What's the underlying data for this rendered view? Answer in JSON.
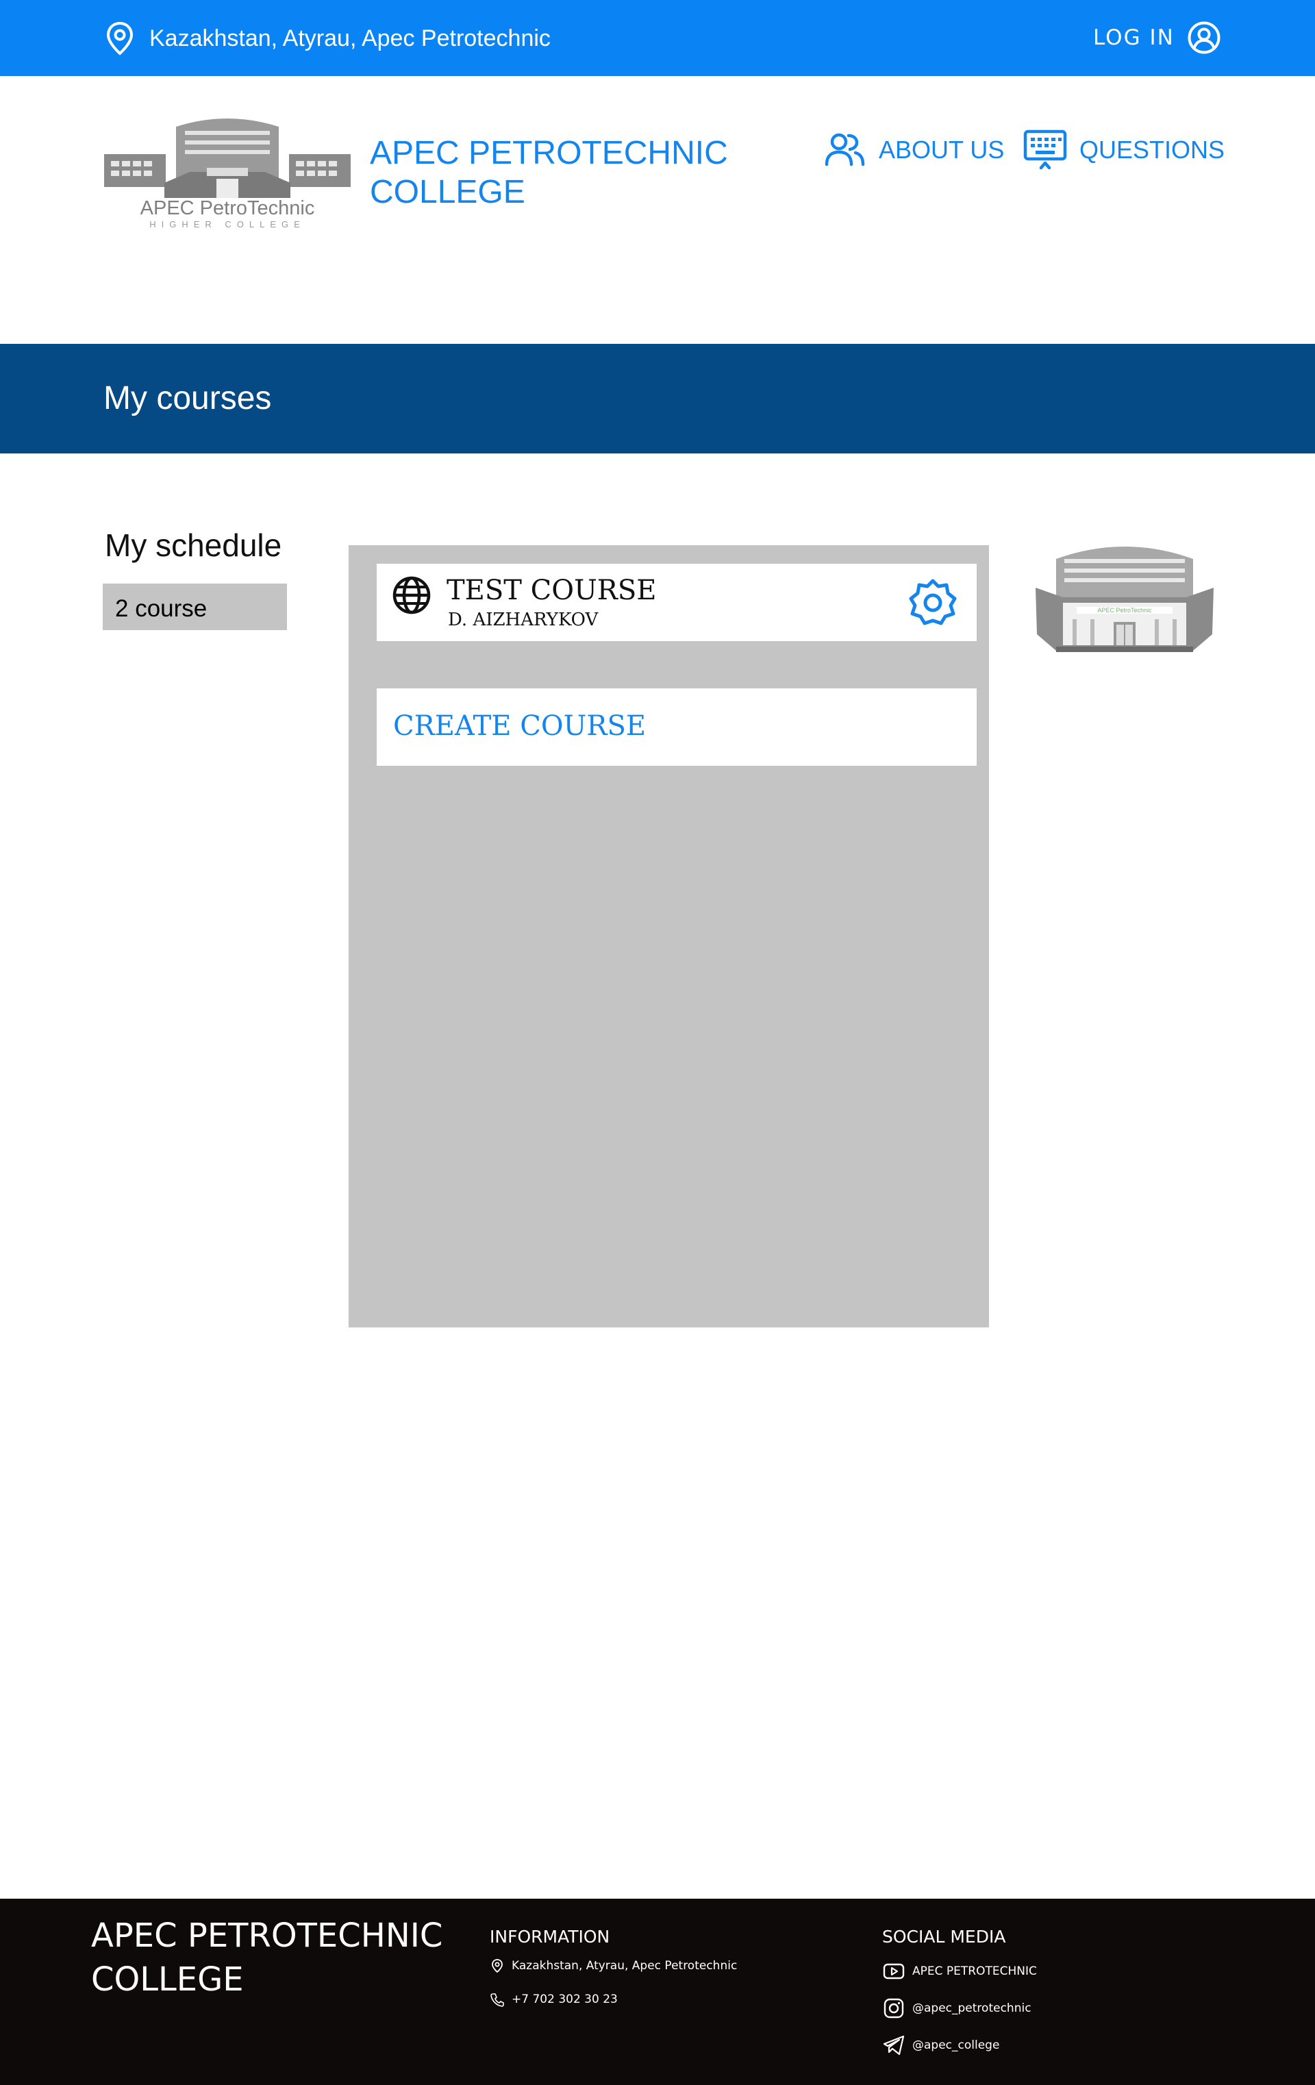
{
  "topbar": {
    "location": "Kazakhstan, Atyrau, Apec Petrotechnic",
    "login_label": "LOG IN",
    "location_icon": "map-pin-icon",
    "login_icon": "user-circle-icon",
    "background": "#0a84f5"
  },
  "header": {
    "logo_text": "APEC PetroTechnic",
    "logo_subtext": "HIGHER COLLEGE",
    "title_line1": "APEC PETROTECHNIC",
    "title_line2": "COLLEGE",
    "nav": [
      {
        "label": "ABOUT US",
        "icon": "users-icon"
      },
      {
        "label": "QUESTIONS",
        "icon": "keyboard-icon"
      }
    ],
    "accent": "#1585ee"
  },
  "banner": {
    "title": "My courses",
    "background": "#054a85"
  },
  "sidebar": {
    "title": "My schedule",
    "items": [
      "2 course"
    ]
  },
  "courses": {
    "items": [
      {
        "title": "TEST COURSE",
        "teacher": "D. AIZHARYKOV",
        "icon": "globe-icon",
        "action_icon": "gear-icon"
      }
    ],
    "create_label": "CREATE COURSE",
    "panel_color": "#c4c4c4"
  },
  "building_image": {
    "sign_text": "APEC PetroTechnic"
  },
  "footer": {
    "title_line1": "APEC PETROTECHNIC",
    "title_line2": "COLLEGE",
    "info_heading": "INFORMATION",
    "address": "Kazakhstan, Atyrau, Apec Petrotechnic",
    "phone": "+7 702 302 30 23",
    "social_heading": "SOCIAL MEDIA",
    "social": [
      {
        "label": "APEC PETROTECHNIC",
        "icon": "youtube-icon"
      },
      {
        "label": "@apec_petrotechnic",
        "icon": "instagram-icon"
      },
      {
        "label": "@apec_college",
        "icon": "telegram-icon"
      }
    ],
    "background": "#0e0a0a"
  }
}
